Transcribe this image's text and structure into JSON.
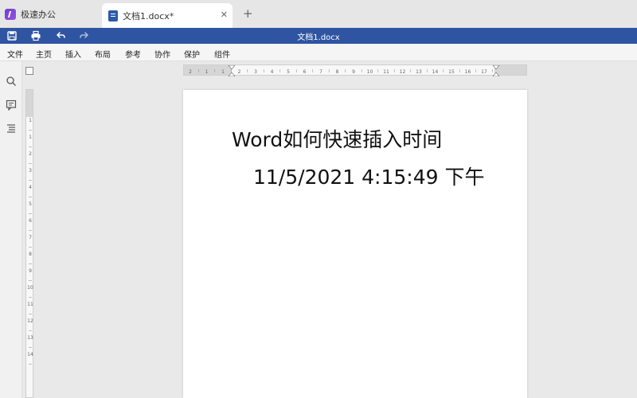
{
  "tabs": {
    "app_label": "极速办公",
    "doc_label": "文档1.docx*",
    "close_glyph": "✕",
    "new_glyph": "+"
  },
  "title_bar": {
    "title": "文档1.docx",
    "quick_access": [
      "save-icon",
      "print-icon",
      "undo-icon",
      "redo-icon"
    ],
    "color": "#2f55a2"
  },
  "menu": {
    "items": [
      "文件",
      "主页",
      "插入",
      "布局",
      "参考",
      "协作",
      "保护",
      "组件"
    ]
  },
  "sidebar": {
    "icons": [
      "search-icon",
      "comment-icon",
      "navigation-icon"
    ]
  },
  "document": {
    "line1": "Word如何快速插入时间",
    "line2": "11/5/2021 4:15:49 下午"
  },
  "ruler": {
    "h_labels": [
      "2",
      "1",
      "1",
      "2",
      "3",
      "4",
      "5",
      "6",
      "7",
      "8",
      "9",
      "10",
      "11",
      "12",
      "13",
      "14",
      "15",
      "16",
      "17"
    ],
    "v_labels": [
      "1",
      "1",
      "2",
      "3",
      "4",
      "5",
      "6",
      "7",
      "8",
      "9",
      "10",
      "11",
      "12",
      "13",
      "14"
    ]
  },
  "colors": {
    "accent": "#2f55a2",
    "app_logo": "#7a45dc",
    "page": "#ffffff",
    "workspace": "#e9e9e9"
  }
}
